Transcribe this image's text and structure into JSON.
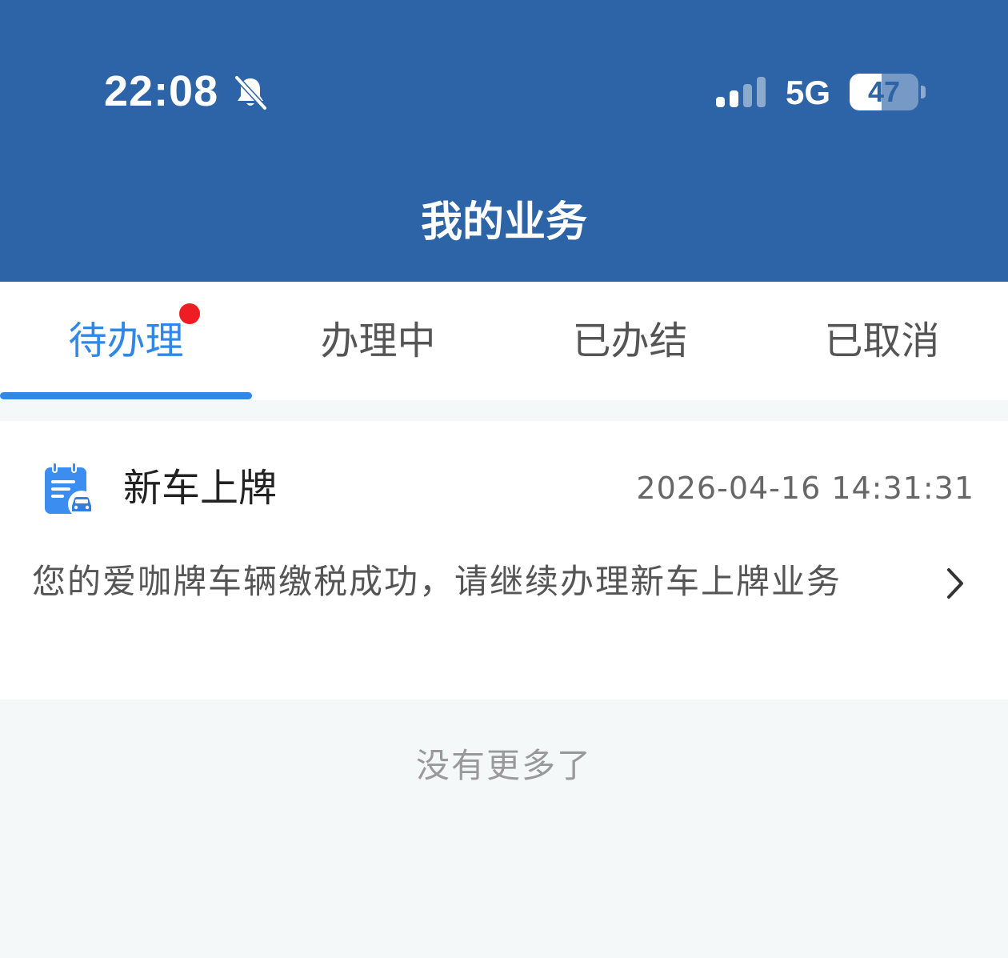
{
  "status_bar": {
    "time": "22:08",
    "network": "5G",
    "battery_level": "47",
    "battery_fraction": 0.47,
    "icons": [
      "bell-muted-icon",
      "cellular-signal-icon",
      "battery-icon"
    ]
  },
  "header": {
    "title": "我的业务",
    "background_color": "#2d64a7"
  },
  "tabs": [
    {
      "label": "待办理",
      "active": true,
      "has_badge": true
    },
    {
      "label": "办理中",
      "active": false,
      "has_badge": false
    },
    {
      "label": "已办结",
      "active": false,
      "has_badge": false
    },
    {
      "label": "已取消",
      "active": false,
      "has_badge": false
    }
  ],
  "tab_colors": {
    "active": "#2f87e8",
    "inactive": "#555555",
    "badge": "#ee1d23"
  },
  "business_list": [
    {
      "icon": "calendar-car-icon",
      "title": "新车上牌",
      "time": "2026-04-16 14:31:31",
      "message": "您的爱咖牌车辆缴税成功，请继续办理新车上牌业务"
    }
  ],
  "footer": {
    "text": "没有更多了"
  }
}
